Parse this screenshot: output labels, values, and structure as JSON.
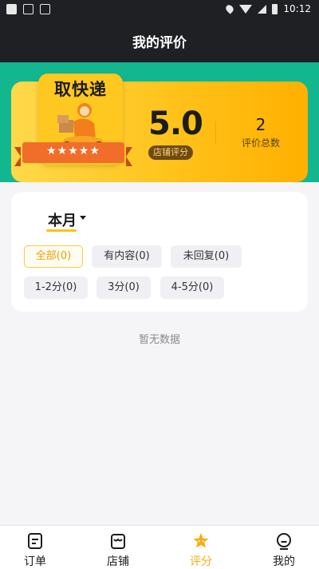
{
  "status_bar": {
    "time": "10:12"
  },
  "header": {
    "title": "我的评价"
  },
  "summary": {
    "logo_text": "取快递",
    "stars": "★★★★★",
    "score": "5.0",
    "score_label": "店铺评分",
    "total": "2",
    "total_label": "评价总数"
  },
  "filter": {
    "period": "本月",
    "chips_row1": [
      "全部(0)",
      "有内容(0)",
      "未回复(0)"
    ],
    "chips_row2": [
      "1-2分(0)",
      "3分(0)",
      "4-5分(0)"
    ],
    "active_chip": "全部(0)"
  },
  "empty_text": "暂无数据",
  "tabs": [
    {
      "label": "订单",
      "icon": "order-icon",
      "active": false
    },
    {
      "label": "店铺",
      "icon": "store-icon",
      "active": false
    },
    {
      "label": "评分",
      "icon": "star-icon",
      "active": true
    },
    {
      "label": "我的",
      "icon": "profile-icon",
      "active": false
    }
  ],
  "colors": {
    "accent": "#f6ae0f",
    "teal": "#13b78f",
    "header": "#1f2024"
  }
}
